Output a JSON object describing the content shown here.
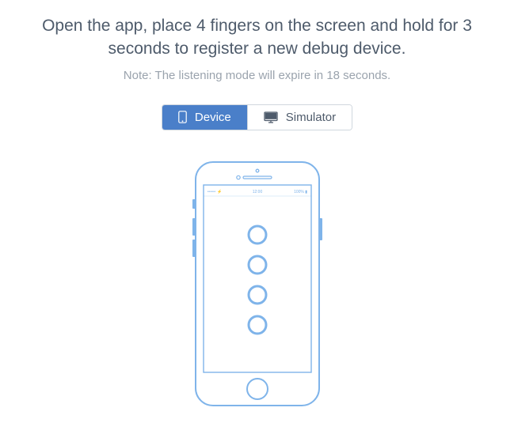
{
  "instruction": "Open the app, place 4 fingers on the screen and hold for 3 seconds to register a new debug device.",
  "note": "Note: The listening mode will expire in 18 seconds.",
  "toggle": {
    "device_label": "Device",
    "simulator_label": "Simulator",
    "active": "device"
  },
  "colors": {
    "accent": "#4a7fc9",
    "phone_line": "#7fb4ea"
  }
}
